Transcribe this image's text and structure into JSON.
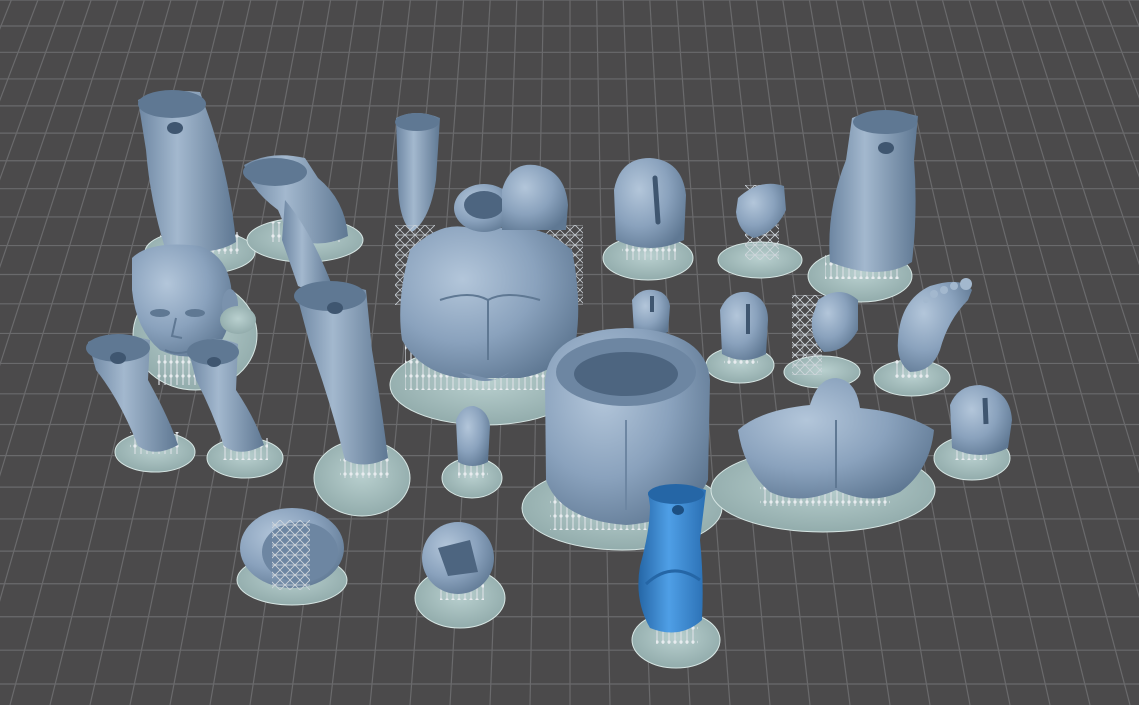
{
  "app": {
    "view": "3d-print-build-plate-viewport"
  },
  "colors": {
    "background": "#4b4a4b",
    "grid_line": "#6a6a6c",
    "part": "#8aa2bd",
    "part_shadow": "#5f7893",
    "part_highlight": "#b3c6da",
    "selected_part": "#3f8fd6",
    "selected_shadow": "#2566a6",
    "raft": "#a9c2c2",
    "raft_edge": "#d7e6e4",
    "support": "#d8dde2"
  },
  "scene": {
    "part_count": 23,
    "selected_part": "lower-leg-selected"
  }
}
